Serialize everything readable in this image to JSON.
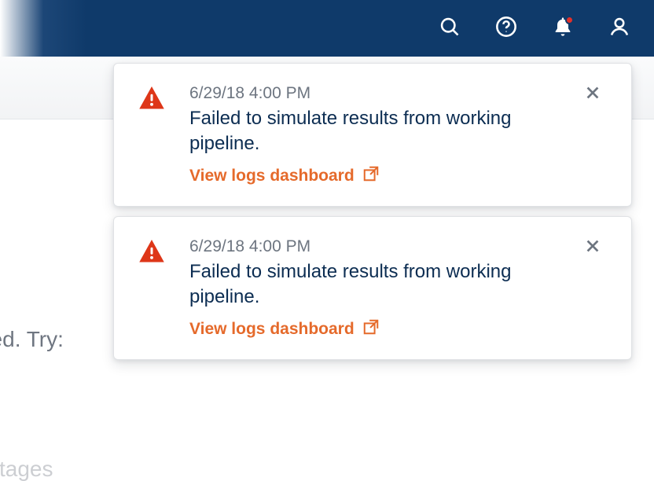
{
  "background": {
    "text_fragment_1": "ired. Try:",
    "text_fragment_2": "stages"
  },
  "notifications": [
    {
      "timestamp": "6/29/18 4:00 PM",
      "message": "Failed to simulate results from working pipeline.",
      "link_label": "View logs dashboard"
    },
    {
      "timestamp": "6/29/18 4:00 PM",
      "message": "Failed to simulate results from working pipeline.",
      "link_label": "View logs dashboard"
    }
  ]
}
